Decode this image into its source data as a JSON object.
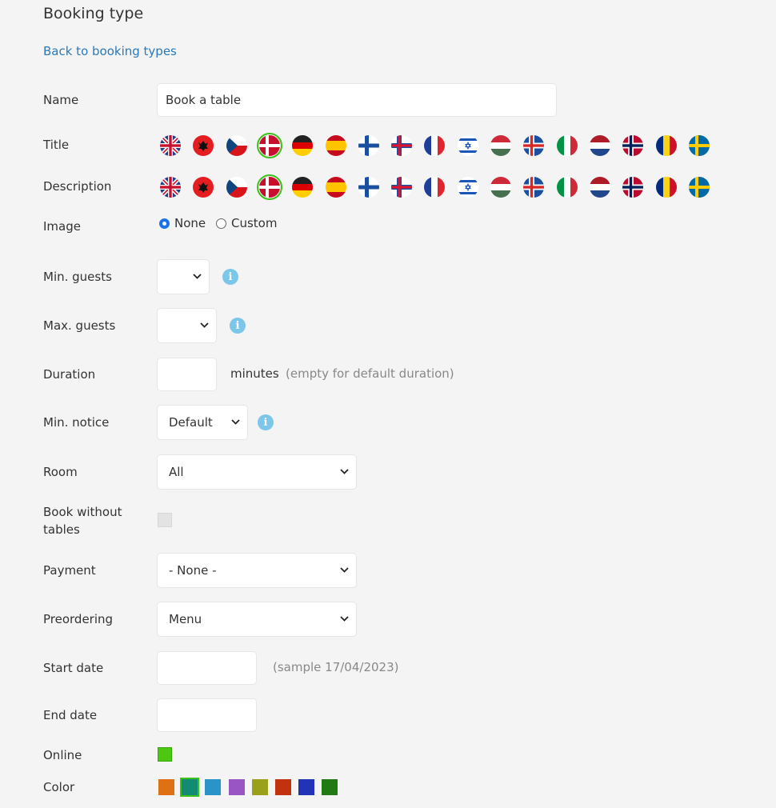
{
  "page": {
    "title": "Booking type",
    "back_link": "Back to booking types"
  },
  "labels": {
    "name": "Name",
    "title": "Title",
    "description": "Description",
    "image": "Image",
    "min_guests": "Min. guests",
    "max_guests": "Max. guests",
    "duration": "Duration",
    "min_notice": "Min. notice",
    "room": "Room",
    "book_without_tables_1": "Book without",
    "book_without_tables_2": "tables",
    "payment": "Payment",
    "preordering": "Preordering",
    "start_date": "Start date",
    "end_date": "End date",
    "online": "Online",
    "color": "Color"
  },
  "fields": {
    "name_value": "Book a table",
    "image_options": [
      "None",
      "Custom"
    ],
    "image_selected": "None",
    "min_guests_value": "",
    "max_guests_value": "",
    "duration_value": "",
    "duration_unit": "minutes",
    "duration_hint": "(empty for default duration)",
    "min_notice_value": "Default",
    "room_value": "All",
    "book_without_tables_checked": false,
    "payment_value": "- None -",
    "preordering_value": "Menu",
    "start_date_value": "",
    "start_date_hint": "(sample 17/04/2023)",
    "end_date_value": "",
    "online_checked": true
  },
  "languages": [
    "english",
    "albanian",
    "czech",
    "danish",
    "german",
    "spanish",
    "finnish",
    "faroese",
    "french",
    "hebrew",
    "hungarian",
    "icelandic",
    "italian",
    "dutch",
    "norwegian",
    "romanian",
    "swedish"
  ],
  "selected_language": "danish",
  "colors": [
    "#e07014",
    "#128a74",
    "#2a93c8",
    "#9a55c4",
    "#9aa01a",
    "#c0330e",
    "#2233b8",
    "#227a14"
  ],
  "selected_color": "#128a74",
  "accent": {
    "link": "#2a7ab8",
    "selected": "#3bc21a",
    "online": "#4cc812",
    "info": "#7cc6ea"
  }
}
